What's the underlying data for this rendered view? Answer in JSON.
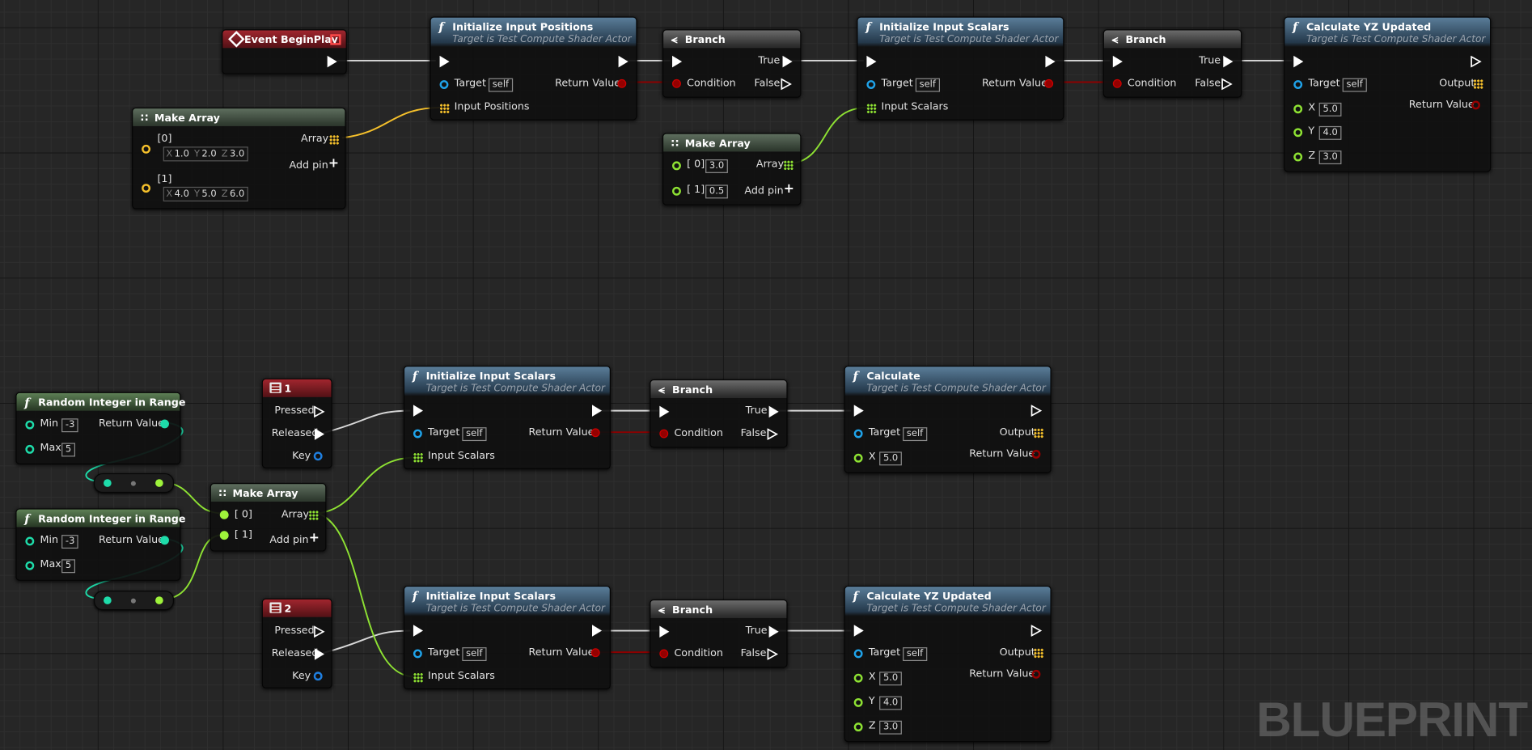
{
  "watermark": "BLUEPRINT",
  "common": {
    "target_subtitle": "Target is Test Compute Shader Actor",
    "target_label": "Target",
    "self_label": "self",
    "return_value": "Return Value",
    "condition": "Condition",
    "true_label": "True",
    "false_label": "False",
    "array_label": "Array",
    "add_pin": "Add pin",
    "output_label": "Output",
    "input_positions": "Input Positions",
    "input_scalars": "Input Scalars",
    "pressed": "Pressed",
    "released": "Released",
    "key": "Key",
    "min_label": "Min",
    "max_label": "Max",
    "x_label": "X",
    "y_label": "Y",
    "z_label": "Z",
    "idx0": "[ 0]",
    "idx1": "[ 1]",
    "idx0b": "[0]",
    "idx1b": "[1]"
  },
  "nodes": {
    "event_begin_play": {
      "title": "Event BeginPlay"
    },
    "init_positions": {
      "title": "Initialize Input Positions"
    },
    "branch": {
      "title": "Branch"
    },
    "init_scalars": {
      "title": "Initialize Input Scalars"
    },
    "calc_yz": {
      "title": "Calculate YZ Updated",
      "x": "5.0",
      "y": "4.0",
      "z": "3.0"
    },
    "make_array": {
      "title": "Make Array"
    },
    "make_array_vec": {
      "e0": {
        "x": "1.0",
        "y": "2.0",
        "z": "3.0"
      },
      "e1": {
        "x": "4.0",
        "y": "5.0",
        "z": "6.0"
      }
    },
    "make_array_float": {
      "e0": "3.0",
      "e1": "0.5"
    },
    "random_int": {
      "title": "Random Integer in Range",
      "min": "-3",
      "max": "5"
    },
    "key1": {
      "title": "1"
    },
    "key2": {
      "title": "2"
    },
    "calculate": {
      "title": "Calculate",
      "x": "5.0"
    },
    "calc_yz_bottom": {
      "x": "5.0",
      "y": "4.0",
      "z": "3.0"
    }
  }
}
